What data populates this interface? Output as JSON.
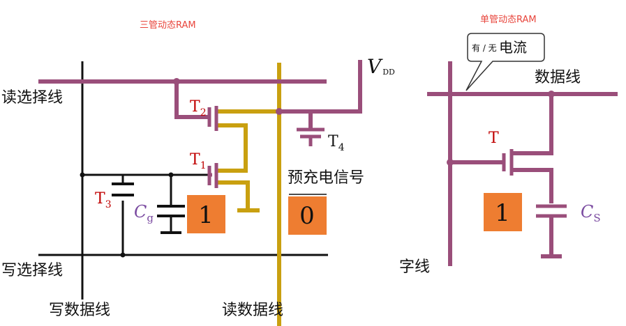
{
  "three_tube": {
    "title": "三管动态RAM",
    "read_select_line": "读选择线",
    "write_select_line": "写选择线",
    "write_data_line": "写数据线",
    "read_data_line": "读数据线",
    "precharge_signal": "预充电信号",
    "vdd": {
      "main": "V",
      "sub": "DD"
    },
    "t1": {
      "main": "T",
      "sub": "1"
    },
    "t2": {
      "main": "T",
      "sub": "2"
    },
    "t3": {
      "main": "T",
      "sub": "3"
    },
    "t4": {
      "main": "T",
      "sub": "4"
    },
    "cg": {
      "main": "C",
      "sub": "g"
    },
    "stored_value": "1",
    "read_value": "0"
  },
  "single_tube": {
    "title": "单管动态RAM",
    "callout_small": "有 / 无",
    "callout_big": "电流",
    "data_line": "数据线",
    "word_line": "字线",
    "t": "T",
    "cs": {
      "main": "C",
      "sub": "S"
    },
    "stored_value": "1"
  },
  "colors": {
    "wire_purple": "#9a4e7a",
    "wire_gold": "#c9a010",
    "box_orange": "#ee7d31",
    "wire_black": "#111111",
    "title_red": "#e8453c",
    "transistor_red": "#c00000"
  }
}
